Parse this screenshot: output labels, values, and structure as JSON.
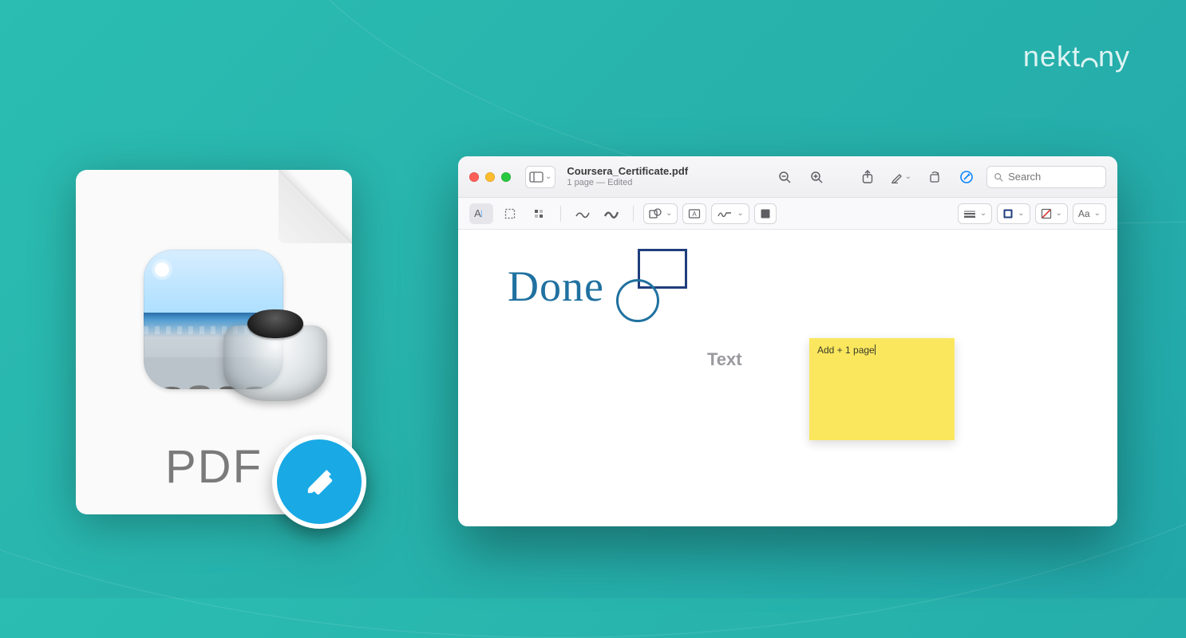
{
  "brand": {
    "name": "nektony"
  },
  "pdf_icon": {
    "label": "PDF"
  },
  "window": {
    "doc_title": "Coursera_Certificate.pdf",
    "doc_subtitle": "1 page — Edited",
    "search_placeholder": "Search"
  },
  "canvas": {
    "handwritten": "Done",
    "text_label": "Text",
    "sticky_note": "Add + 1 page"
  },
  "colors": {
    "accent_blue": "#0a84ff",
    "ink_blue": "#1f71a0",
    "rect_navy": "#1f3e7c",
    "sticky_yellow": "#fbe75e",
    "edit_badge": "#19a9e5"
  }
}
